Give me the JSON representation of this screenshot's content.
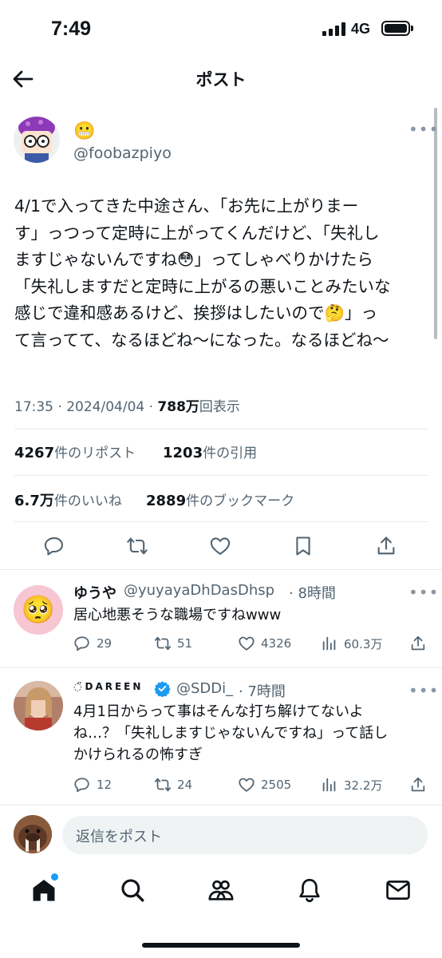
{
  "status_bar": {
    "time": "7:49",
    "network": "4G",
    "battery_level": 1.0
  },
  "header": {
    "title": "ポスト"
  },
  "post": {
    "author_emoji": "😬",
    "author_handle": "@foobazpiyo",
    "body_lines": [
      "4/1で入ってきた中途さん、「お先に上がりまー",
      "す」っつって定時に上がってくんだけど、「失礼し",
      "ますじゃないんですね😳」ってしゃべりかけたら",
      "「失礼しますだと定時に上がるの悪いことみたいな",
      "感じで違和感あるけど、挨拶はしたいので🤔」っ",
      "て言ってて、なるほどね〜になった。なるほどね〜"
    ],
    "time": "17:35",
    "dot1": "·",
    "date": "2024/04/04",
    "dot2": "·",
    "views": "788万",
    "views_label": "回表示",
    "reposts": "4267",
    "reposts_label": "件のリポスト",
    "quotes": "1203",
    "quotes_label": "件の引用",
    "likes": "6.7万",
    "likes_label": "件のいいね",
    "bookmarks": "2889",
    "bookmarks_label": "件のブックマーク"
  },
  "replies": [
    {
      "name": "ゆうや",
      "handle": "@yuyayaDhDasDhsp",
      "time": "· 8時間",
      "avatar_emoji": "🥺",
      "text_lines": [
        "居心地悪そうな職場ですねwww"
      ],
      "replies": "29",
      "reposts": "51",
      "likes": "4326",
      "views": "60.3万"
    },
    {
      "name": "DAREEN",
      "name_prefix": "◌̈",
      "handle": "@SDDi_",
      "time": "· 7時間",
      "verified": true,
      "text_lines": [
        "4月1日からって事はそんな打ち解けてないよ",
        "ね…？「失礼しますじゃないんですね」って話し",
        "かけられるの怖すぎ"
      ],
      "replies": "12",
      "reposts": "24",
      "likes": "2505",
      "views": "32.2万"
    }
  ],
  "composer": {
    "placeholder": "返信をポスト"
  },
  "colors": {
    "accent": "#1d9bf0",
    "text": "#0f1419",
    "muted": "#536471",
    "divider": "#e6e9eb"
  },
  "icons": [
    "back-arrow-icon",
    "more-icon",
    "reply-icon",
    "repost-icon",
    "like-icon",
    "bookmark-icon",
    "share-icon",
    "views-icon",
    "verified-icon",
    "home-icon",
    "search-icon",
    "communities-icon",
    "notifications-icon",
    "messages-icon"
  ]
}
